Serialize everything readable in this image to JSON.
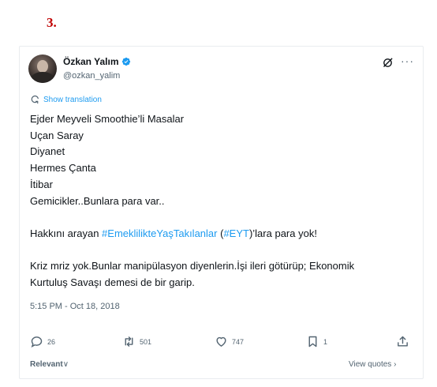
{
  "page_marker": "3.",
  "author": {
    "name": "Özkan Yalım",
    "handle": "@ozkan_yalim"
  },
  "translate_label": "Show translation",
  "tweet": {
    "lines": [
      "Ejder Meyveli Smoothie’li Masalar",
      "Uçan Saray",
      "Diyanet",
      "Hermes Çanta",
      "İtibar",
      "Gemicikler..Bunlara para var.."
    ],
    "para2_prefix": "Hakkını arayan ",
    "hashtag1": "#EmeklilikteYaşTakılanlar",
    "para2_mid1": " (",
    "hashtag2": "#EYT",
    "para2_suffix": ")’lara para yok!",
    "para3_line1": "Kriz mriz yok.Bunlar manipülasyon diyenlerin.İşi ileri götürüp; Ekonomik",
    "para3_line2": "Kurtuluş Savaşı demesi de bir garip."
  },
  "timestamp": "5:15 PM - Oct 18, 2018",
  "actions": {
    "replies": "26",
    "reposts": "501",
    "likes": "747",
    "bookmarks": "1"
  },
  "footer": {
    "sort_label": "Relevant",
    "view_quotes": "View quotes"
  },
  "colors": {
    "accent": "#1d9bf0",
    "page_marker": "#c00000",
    "muted": "#536471"
  }
}
